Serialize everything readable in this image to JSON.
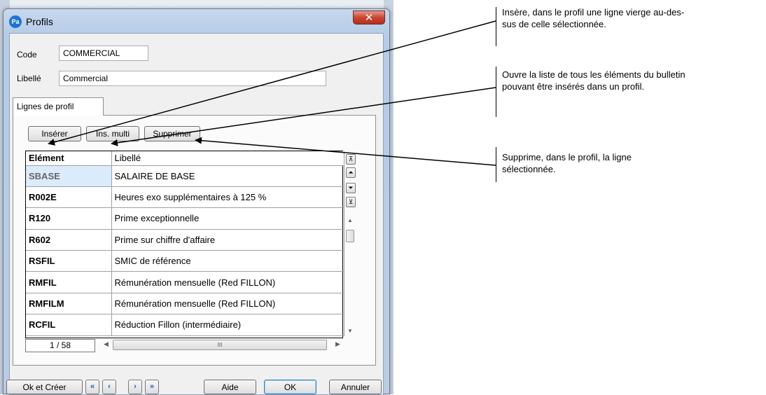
{
  "window": {
    "title": "Profils",
    "app_icon_text": "Pa",
    "close_glyph": "✕"
  },
  "form": {
    "code_label": "Code",
    "code_value": "COMMERCIAL",
    "libelle_label": "Libellé",
    "libelle_value": "Commercial"
  },
  "tab": {
    "label": "Lignes de profil"
  },
  "toolbar": {
    "inserer": "Insérer",
    "ins_multi": "Ins. multi",
    "supprimer": "Supprimer"
  },
  "grid": {
    "columns": [
      "Elément",
      "Libellé"
    ],
    "rows": [
      {
        "code": "SBASE",
        "label": "SALAIRE DE BASE"
      },
      {
        "code": "R002E",
        "label": "Heures exo supplémentaires à 125 %"
      },
      {
        "code": "R120",
        "label": "Prime exceptionnelle"
      },
      {
        "code": "R602",
        "label": "Prime sur chiffre d'affaire"
      },
      {
        "code": "RSFIL",
        "label": "SMIC de référence"
      },
      {
        "code": "RMFIL",
        "label": "Rémunération mensuelle (Red FILLON)"
      },
      {
        "code": "RMFILM",
        "label": "Rémunération mensuelle (Red FILLON)"
      },
      {
        "code": "RCFIL",
        "label": "Réduction Fillon (intermédiaire)"
      }
    ],
    "selected_row": 0,
    "counter": "1 / 58",
    "hscroll_grip": "III"
  },
  "footer": {
    "ok_creer": "Ok et Créer",
    "aide": "Aide",
    "ok": "OK",
    "annuler": "Annuler"
  },
  "annotations": {
    "inserer": "Insère, dans le profil une ligne vierge au-des-\nsus de celle sélectionnée.",
    "ins_multi": "Ouvre la liste de tous les éléments du bulletin\npouvant être insérés dans un profil.",
    "supprimer": "Supprime, dans le profil, la ligne\nsélectionnée."
  }
}
